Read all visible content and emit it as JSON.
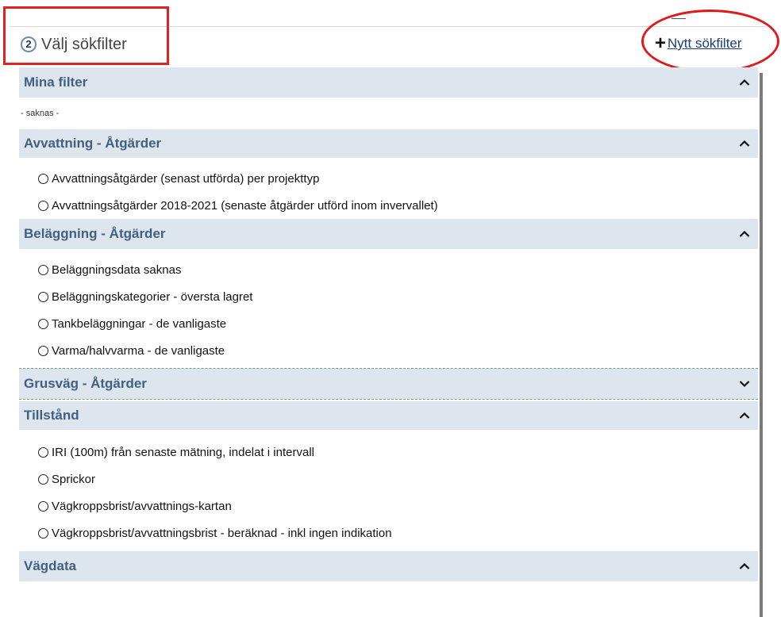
{
  "header": {
    "step_number": "2",
    "title": "Välj sökfilter",
    "new_filter_label": "Nytt sökfilter",
    "new_filter_plus": "+"
  },
  "sections": [
    {
      "title": "Mina filter",
      "expanded": true,
      "empty_text": "- saknas -",
      "items": []
    },
    {
      "title": "Avvattning - Åtgärder",
      "expanded": true,
      "items": [
        "Avvattningsåtgärder (senast utförda) per projekttyp",
        "Avvattningsåtgärder 2018-2021 (senaste åtgärder utförd inom invervallet)"
      ]
    },
    {
      "title": "Beläggning - Åtgärder",
      "expanded": true,
      "items": [
        "Beläggningsdata saknas",
        "Beläggningskategorier - översta lagret",
        "Tankbeläggningar - de vanligaste",
        "Varma/halvvarma - de vanligaste"
      ]
    },
    {
      "title": "Grusväg - Åtgärder",
      "expanded": false,
      "items": []
    },
    {
      "title": "Tillstånd",
      "expanded": true,
      "items": [
        "IRI (100m) från senaste mätning, indelat i intervall",
        "Sprickor",
        "Vägkroppsbrist/avvattnings-kartan",
        "Vägkroppsbrist/avvattningsbrist - beräknad - inkl ingen indikation"
      ]
    },
    {
      "title": "Vägdata",
      "expanded": true,
      "items": []
    }
  ],
  "icons": {
    "collapse": "chevron-up-icon",
    "expand": "chevron-down-icon",
    "radio": "radio-icon"
  },
  "colors": {
    "section_header_bg": "#dde5ee",
    "section_header_text": "#44607f",
    "annotation_red": "#e01a1a",
    "link": "#1a3e77"
  }
}
